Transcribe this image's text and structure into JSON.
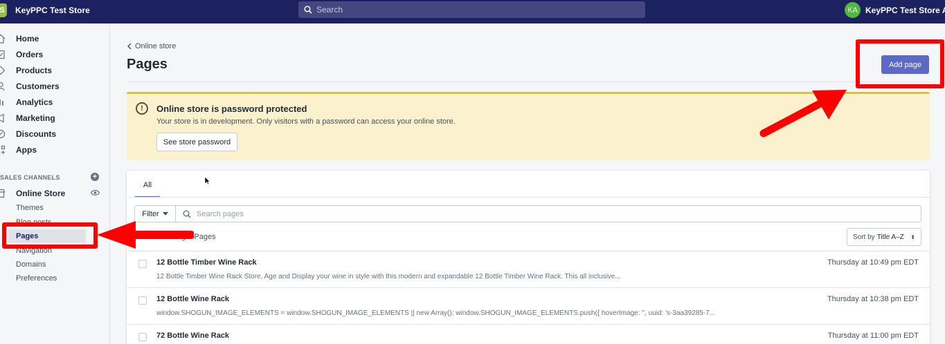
{
  "topbar": {
    "store_name": "KeyPPC Test Store",
    "search_placeholder": "Search",
    "avatar_initials": "KA",
    "user_name": "KeyPPC Test Store Ad..."
  },
  "sidebar": {
    "items": [
      {
        "label": "Home",
        "icon": "home-icon"
      },
      {
        "label": "Orders",
        "icon": "orders-icon"
      },
      {
        "label": "Products",
        "icon": "tag-icon"
      },
      {
        "label": "Customers",
        "icon": "person-icon"
      },
      {
        "label": "Analytics",
        "icon": "bar-chart-icon"
      },
      {
        "label": "Marketing",
        "icon": "megaphone-icon"
      },
      {
        "label": "Discounts",
        "icon": "discount-icon"
      },
      {
        "label": "Apps",
        "icon": "apps-icon"
      }
    ],
    "sales_channels_header": "SALES CHANNELS",
    "online_store_label": "Online Store",
    "sub_items": [
      "Themes",
      "Blog posts",
      "Pages",
      "Navigation",
      "Domains",
      "Preferences"
    ]
  },
  "main": {
    "breadcrumb": "Online store",
    "title": "Pages",
    "add_button": "Add page",
    "banner": {
      "title": "Online store is password protected",
      "text": "Your store is in development. Only visitors with a password can access your online store.",
      "button": "See store password"
    },
    "tabs": [
      "All"
    ],
    "filter_label": "Filter",
    "search_placeholder": "Search pages",
    "showing": "Showing 7 Pages",
    "sort_prefix": "Sort by",
    "sort_value": "Title A–Z",
    "rows": [
      {
        "title": "12 Bottle Timber Wine Rack",
        "desc": "12 Bottle Timber Wine Rack Store, Age and Display your wine in style with this modern and expandable 12 Bottle Timber Wine Rack. This all inclusive...",
        "date": "Thursday at 10:49 pm EDT"
      },
      {
        "title": "12 Bottle Wine Rack",
        "desc": "window.SHOGUN_IMAGE_ELEMENTS = window.SHOGUN_IMAGE_ELEMENTS || new Array(); window.SHOGUN_IMAGE_ELEMENTS.push({ hoverImage: '', uuid: 's-3aa39285-7...",
        "date": "Thursday at 10:38 pm EDT"
      },
      {
        "title": "72 Bottle Wine Rack",
        "desc": "",
        "date": "Thursday at 11:00 pm EDT"
      }
    ]
  },
  "colors": {
    "topbar": "#1c2260",
    "accent": "#5c6ac4",
    "banner_bg": "#fcf1cd",
    "annotation": "#ff0000"
  }
}
